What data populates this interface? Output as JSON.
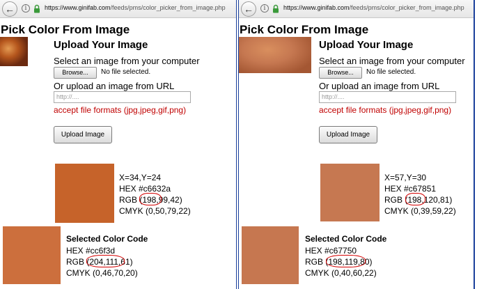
{
  "colors": {
    "accent_border": "#1a3f9b",
    "formats_text": "#c00000",
    "annotation": "#d40000"
  },
  "panels": [
    {
      "browser": {
        "back_icon": "back-arrow-icon",
        "url_domain": "https://www.ginifab.com",
        "url_path": "/feeds/pms/color_picker_from_image.php"
      },
      "page_title": "Pick Color From Image",
      "upload": {
        "title": "Upload Your Image",
        "select_text": "Select an image from your computer",
        "browse_label": "Browse...",
        "no_file_text": "No file selected.",
        "url_text": "Or upload an image from URL",
        "url_placeholder": "http://....",
        "formats_text": "accept file formats (jpg,jpeg,gif,png)",
        "upload_button": "Upload Image"
      },
      "picked": {
        "swatch_color": "#c6632a",
        "coords": "X=34,Y=24",
        "hex": "HEX #c6632a",
        "rgb": "RGB (198,99,42)",
        "cmyk": "CMYK (0,50,79,22)"
      },
      "selected": {
        "title": "Selected Color Code",
        "swatch_color": "#cc6f3d",
        "hex": "HEX #cc6f3d",
        "rgb": "RGB (204,111,61)",
        "cmyk": "CMYK (0,46,70,20)"
      }
    },
    {
      "browser": {
        "back_icon": "back-arrow-icon",
        "url_domain": "https://www.ginifab.com",
        "url_path": "/feeds/pms/color_picker_from_image.php"
      },
      "page_title": "Pick Color From Image",
      "upload": {
        "title": "Upload Your Image",
        "select_text": "Select an image from your computer",
        "browse_label": "Browse...",
        "no_file_text": "No file selected.",
        "url_text": "Or upload an image from URL",
        "url_placeholder": "http://....",
        "formats_text": "accept file formats (jpg,jpeg,gif,png)",
        "upload_button": "Upload Image"
      },
      "picked": {
        "swatch_color": "#c67851",
        "coords": "X=57,Y=30",
        "hex": "HEX #c67851",
        "rgb": "RGB (198,120,81)",
        "cmyk": "CMYK (0,39,59,22)"
      },
      "selected": {
        "title": "Selected Color Code",
        "swatch_color": "#c67750",
        "hex": "HEX #c67750",
        "rgb": "RGB (198,119,80)",
        "cmyk": "CMYK (0,40,60,22)"
      }
    }
  ]
}
